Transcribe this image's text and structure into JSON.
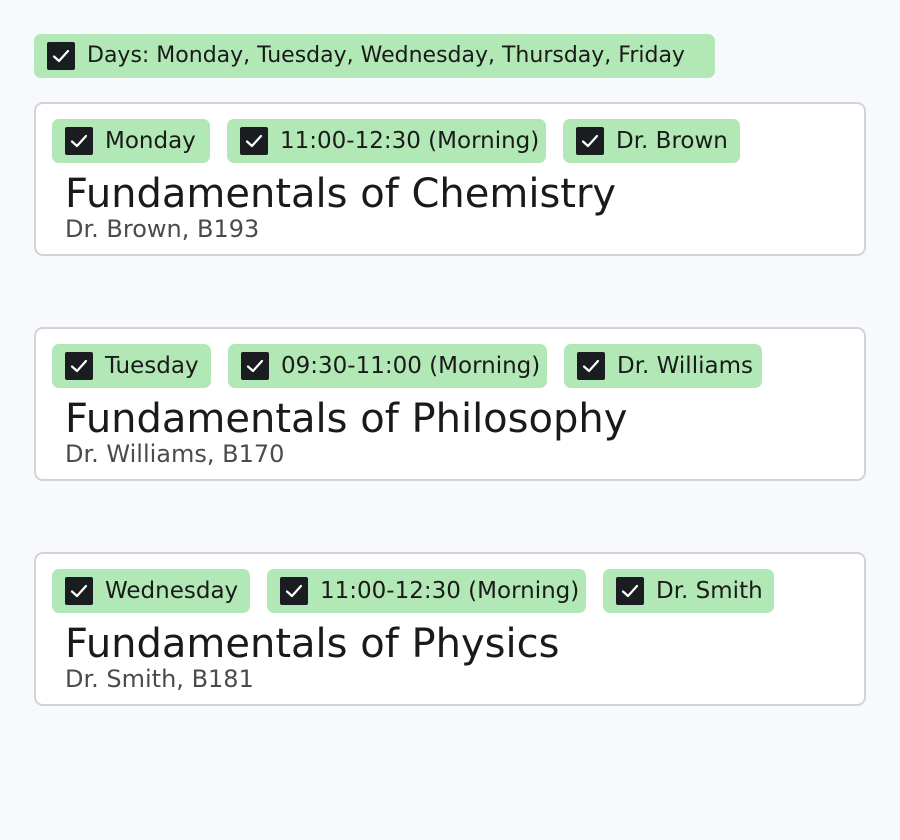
{
  "days_filter": {
    "checked": true,
    "label": "Days: Monday, Tuesday, Wednesday, Thursday, Friday"
  },
  "courses": [
    {
      "chips": [
        {
          "label": "Monday",
          "checked": true
        },
        {
          "label": "11:00-12:30 (Morning)",
          "checked": true
        },
        {
          "label": "Dr. Brown",
          "checked": true
        }
      ],
      "title": "Fundamentals of Chemistry",
      "subtitle": "Dr. Brown, B193"
    },
    {
      "chips": [
        {
          "label": "Tuesday",
          "checked": true
        },
        {
          "label": "09:30-11:00 (Morning)",
          "checked": true
        },
        {
          "label": "Dr. Williams",
          "checked": true
        }
      ],
      "title": "Fundamentals of Philosophy",
      "subtitle": "Dr. Williams, B170"
    },
    {
      "chips": [
        {
          "label": "Wednesday",
          "checked": true
        },
        {
          "label": "11:00-12:30 (Morning)",
          "checked": true
        },
        {
          "label": "Dr. Smith",
          "checked": true
        }
      ],
      "title": "Fundamentals of Physics",
      "subtitle": "Dr. Smith, B181"
    }
  ],
  "colors": {
    "chip_bg": "#b1e8b6",
    "checkbox": "#1a1d1f",
    "page_bg": "#f8f9fd",
    "card_border": "#d2d3d6"
  },
  "icons": {
    "checkbox": "checkbox-checked-icon"
  }
}
